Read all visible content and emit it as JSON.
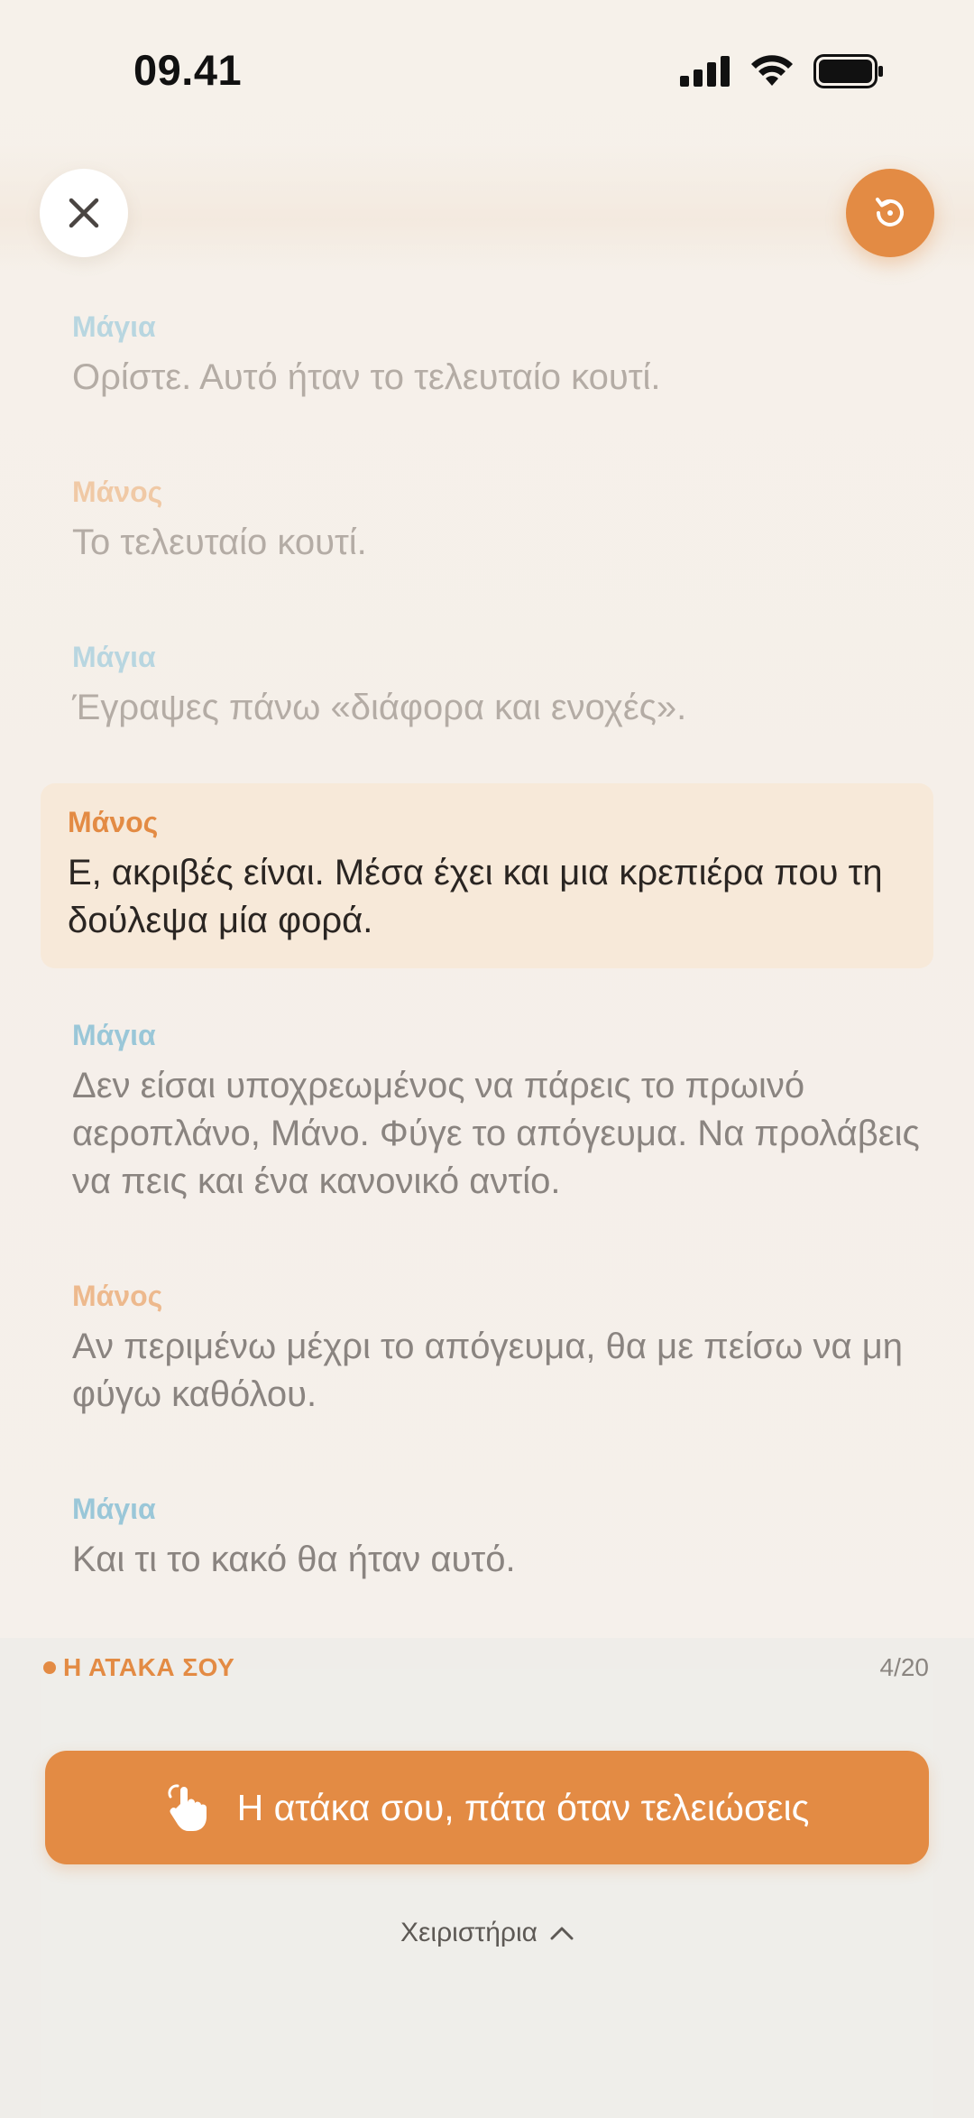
{
  "status_bar": {
    "time": "09.41",
    "icons": [
      "cellular-signal-icon",
      "wifi-icon",
      "battery-icon"
    ]
  },
  "top_controls": {
    "close_icon": "close-icon",
    "reset_icon": "restart-icon",
    "accent_color": "#e38b44"
  },
  "lines": [
    {
      "speaker": "Μάγια",
      "text": "Ορίστε. Αυτό ήταν το τελευταίο κουτί.",
      "state": "past"
    },
    {
      "speaker": "Μάνος",
      "text": "Το τελευταίο κουτί.",
      "state": "past"
    },
    {
      "speaker": "Μάγια",
      "text": "Έγραψες πάνω «διάφορα και ενοχές».",
      "state": "past"
    },
    {
      "speaker": "Μάνος",
      "text": "Ε, ακριβές είναι. Μέσα έχει και μια κρεπιέρα που τη δούλεψα μία φορά.",
      "state": "current"
    },
    {
      "speaker": "Μάγια",
      "text": "Δεν είσαι υποχρεωμένος να πάρεις το πρωινό αεροπλάνο, Μάνο. Φύγε το απόγευμα. Να προλάβεις να πεις και ένα κανονικό αντίο.",
      "state": "upcoming"
    },
    {
      "speaker": "Μάνος",
      "text": "Αν περιμένω μέχρι το απόγευμα, θα με πείσω να μη φύγω καθόλου.",
      "state": "upcoming"
    },
    {
      "speaker": "Μάγια",
      "text": "Και τι το κακό θα ήταν αυτό.",
      "state": "upcoming"
    }
  ],
  "panel": {
    "your_line_label": "Η ΑΤΑΚΑ ΣΟΥ",
    "progress": "4/20",
    "record_button_label": "Η ατάκα σου, πάτα όταν τελειώσεις",
    "record_button_icon": "tap-hand-icon",
    "prompter_label": "Χειριστήρια",
    "prompter_icon": "chevron-up-icon"
  }
}
